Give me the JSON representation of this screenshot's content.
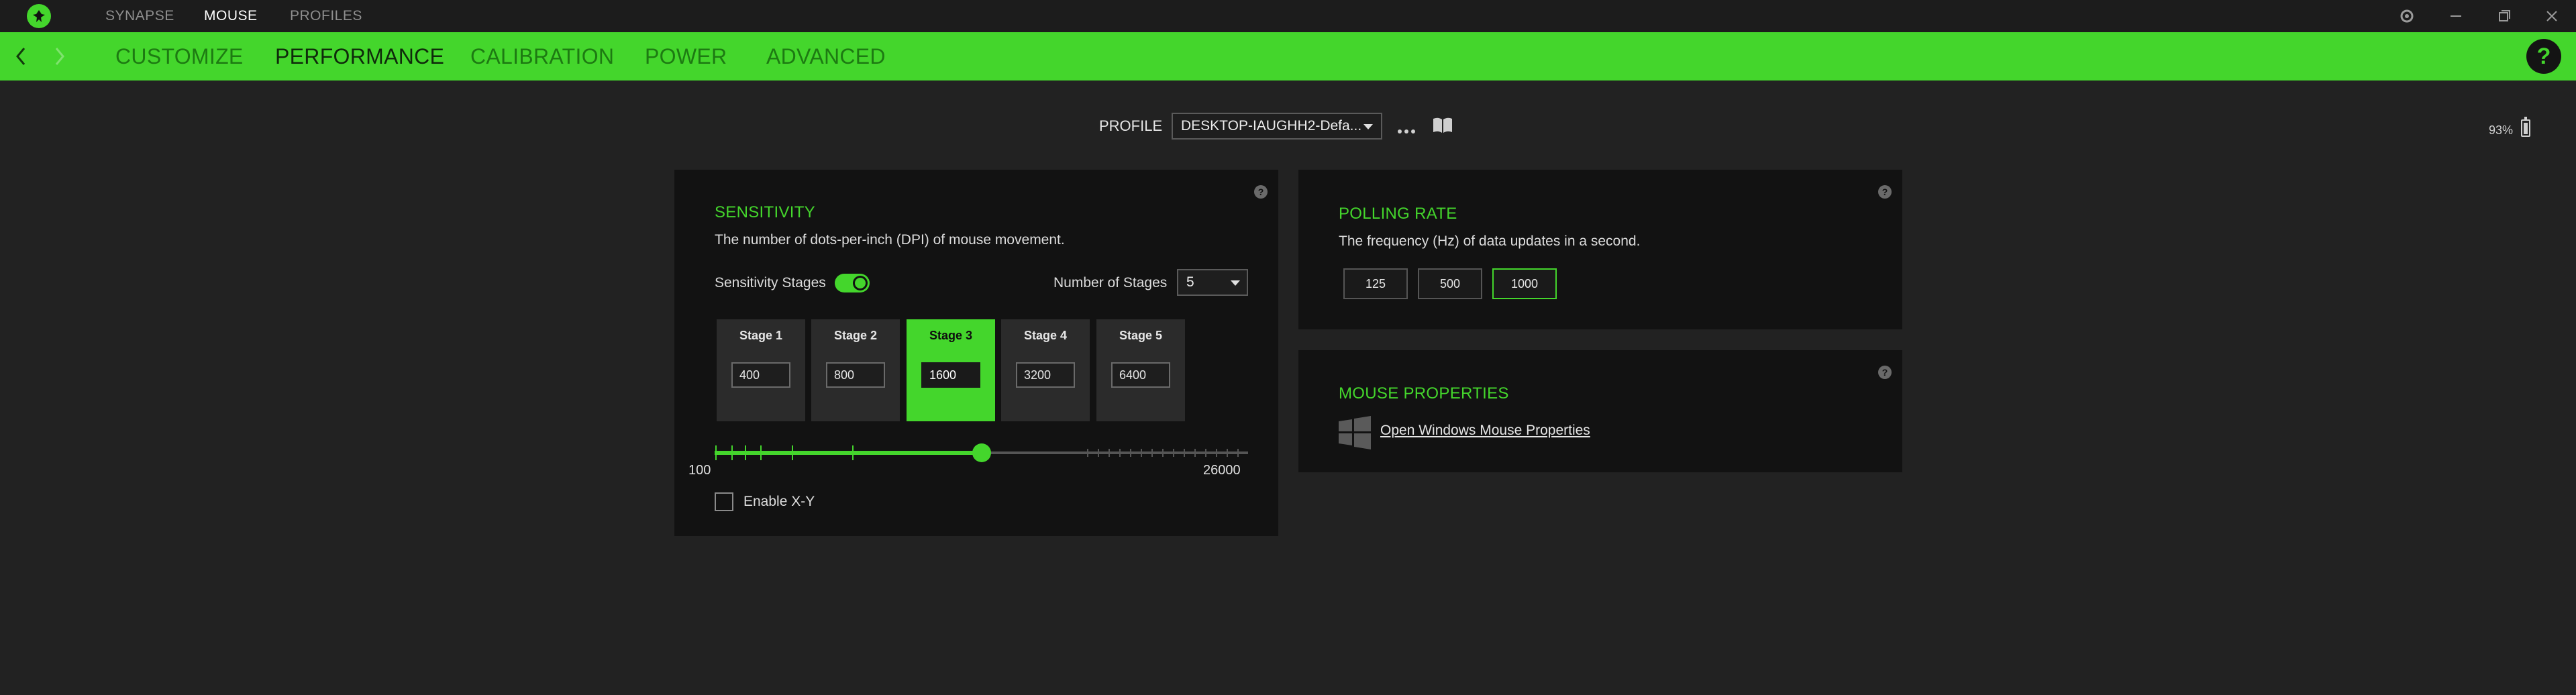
{
  "topbar": {
    "nav": [
      "SYNAPSE",
      "MOUSE",
      "PROFILES"
    ],
    "active_nav": "MOUSE",
    "icons": [
      "razer-logo-icon",
      "settings-icon",
      "minimize-icon",
      "maximize-icon",
      "close-icon"
    ]
  },
  "tabs": [
    "CUSTOMIZE",
    "PERFORMANCE",
    "CALIBRATION",
    "POWER",
    "ADVANCED"
  ],
  "active_tab": "PERFORMANCE",
  "help_label": "?",
  "profile": {
    "label": "PROFILE",
    "selected": "DESKTOP-IAUGHH2-Defa..."
  },
  "battery": {
    "text": "93%",
    "level": 0.93
  },
  "sensitivity": {
    "title": "SENSITIVITY",
    "description": "The number of dots-per-inch (DPI) of mouse movement.",
    "stages_label": "Sensitivity Stages",
    "stages_enabled": true,
    "number_label": "Number of Stages",
    "number_value": "5",
    "stages": [
      {
        "label": "Stage 1",
        "value": "400"
      },
      {
        "label": "Stage 2",
        "value": "800"
      },
      {
        "label": "Stage 3",
        "value": "1600"
      },
      {
        "label": "Stage 4",
        "value": "3200"
      },
      {
        "label": "Stage 5",
        "value": "6400"
      }
    ],
    "active_stage": 3,
    "slider_min": "100",
    "slider_max": "26000",
    "enable_xy_label": "Enable X-Y",
    "enable_xy_checked": false
  },
  "polling": {
    "title": "POLLING RATE",
    "description": "The frequency (Hz) of data updates in a second.",
    "options": [
      "125",
      "500",
      "1000"
    ],
    "selected": "1000"
  },
  "mouse_props": {
    "title": "MOUSE PROPERTIES",
    "link": "Open Windows Mouse Properties"
  },
  "colors": {
    "accent": "#44d62c",
    "background": "#222222",
    "panel": "#121212"
  }
}
